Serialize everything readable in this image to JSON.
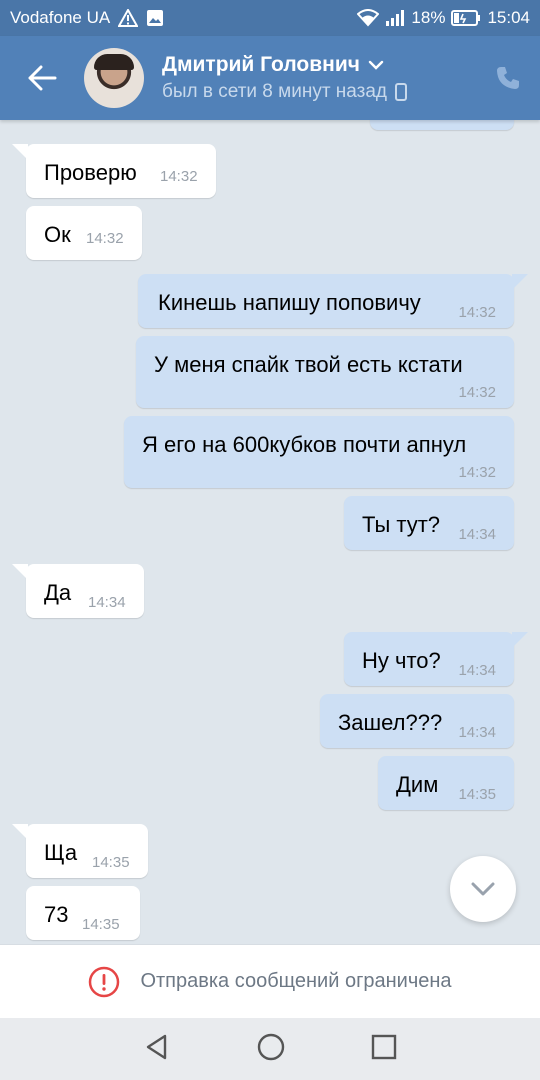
{
  "status_bar": {
    "carrier": "Vodafone UA",
    "battery": "18%",
    "time": "15:04"
  },
  "header": {
    "contact_name": "Дмитрий Головнич",
    "last_seen": "был в сети 8 минут назад"
  },
  "messages": [
    {
      "dir": "in",
      "text": "Проверю",
      "time": "14:32"
    },
    {
      "dir": "in",
      "text": "Ок",
      "time": "14:32"
    },
    {
      "dir": "out",
      "text": "Кинешь напишу поповичу",
      "time": "14:32"
    },
    {
      "dir": "out",
      "text": "У меня спайк твой есть кстати",
      "time": "14:32"
    },
    {
      "dir": "out",
      "text": "Я его на 600кубков почти апнул",
      "time": "14:32"
    },
    {
      "dir": "out",
      "text": "Ты тут?",
      "time": "14:34"
    },
    {
      "dir": "in",
      "text": "Да",
      "time": "14:34"
    },
    {
      "dir": "out",
      "text": "Ну что?",
      "time": "14:34"
    },
    {
      "dir": "out",
      "text": "Зашел???",
      "time": "14:34"
    },
    {
      "dir": "out",
      "text": "Дим",
      "time": "14:35"
    },
    {
      "dir": "in",
      "text": "Ща",
      "time": "14:35"
    },
    {
      "dir": "in",
      "text": "73",
      "time": "14:35"
    }
  ],
  "restriction": {
    "text": "Отправка сообщений ограничена"
  },
  "colors": {
    "header_bg": "#5181b8",
    "incoming_bubble": "#ffffff",
    "outgoing_bubble": "#cddff4",
    "chat_bg": "#dfe6ec",
    "warning_red": "#e64646"
  }
}
